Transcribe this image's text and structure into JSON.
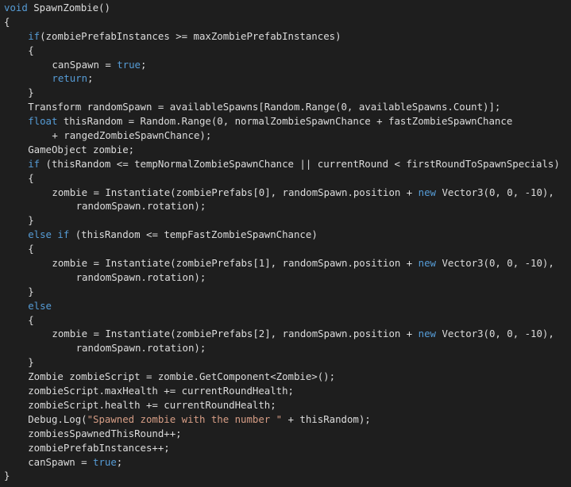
{
  "theme": {
    "background": "#1e1e1e",
    "text_color": "#dcdcdc",
    "keyword_color": "#569cd6",
    "string_color": "#d69d85"
  },
  "code": {
    "language": "C#",
    "lines": [
      {
        "indent": 0,
        "tokens": [
          {
            "t": "kw",
            "v": "void"
          },
          {
            "t": "txt",
            "v": " SpawnZombie()"
          }
        ]
      },
      {
        "indent": 0,
        "tokens": [
          {
            "t": "txt",
            "v": "{"
          }
        ]
      },
      {
        "indent": 1,
        "tokens": [
          {
            "t": "kw",
            "v": "if"
          },
          {
            "t": "txt",
            "v": "(zombiePrefabInstances >= maxZombiePrefabInstances)"
          }
        ]
      },
      {
        "indent": 1,
        "tokens": [
          {
            "t": "txt",
            "v": "{"
          }
        ]
      },
      {
        "indent": 2,
        "tokens": [
          {
            "t": "txt",
            "v": "canSpawn = "
          },
          {
            "t": "kw",
            "v": "true"
          },
          {
            "t": "txt",
            "v": ";"
          }
        ]
      },
      {
        "indent": 2,
        "tokens": [
          {
            "t": "kw",
            "v": "return"
          },
          {
            "t": "txt",
            "v": ";"
          }
        ]
      },
      {
        "indent": 1,
        "tokens": [
          {
            "t": "txt",
            "v": "}"
          }
        ]
      },
      {
        "indent": 1,
        "tokens": [
          {
            "t": "txt",
            "v": "Transform randomSpawn = availableSpawns[Random.Range(0, availableSpawns.Count)];"
          }
        ]
      },
      {
        "indent": 1,
        "tokens": [
          {
            "t": "kw",
            "v": "float"
          },
          {
            "t": "txt",
            "v": " thisRandom = Random.Range(0, normalZombieSpawnChance + fastZombieSpawnChance"
          }
        ]
      },
      {
        "indent": 2,
        "tokens": [
          {
            "t": "txt",
            "v": "+ rangedZombieSpawnChance);"
          }
        ]
      },
      {
        "indent": 1,
        "tokens": [
          {
            "t": "txt",
            "v": "GameObject zombie;"
          }
        ]
      },
      {
        "indent": 1,
        "tokens": [
          {
            "t": "kw",
            "v": "if"
          },
          {
            "t": "txt",
            "v": " (thisRandom <= tempNormalZombieSpawnChance || currentRound < firstRoundToSpawnSpecials)"
          }
        ]
      },
      {
        "indent": 1,
        "tokens": [
          {
            "t": "txt",
            "v": "{"
          }
        ]
      },
      {
        "indent": 2,
        "tokens": [
          {
            "t": "txt",
            "v": "zombie = Instantiate(zombiePrefabs[0], randomSpawn.position + "
          },
          {
            "t": "kw",
            "v": "new"
          },
          {
            "t": "txt",
            "v": " Vector3(0, 0, -10),"
          }
        ]
      },
      {
        "indent": 3,
        "tokens": [
          {
            "t": "txt",
            "v": "randomSpawn.rotation);"
          }
        ]
      },
      {
        "indent": 1,
        "tokens": [
          {
            "t": "txt",
            "v": "}"
          }
        ]
      },
      {
        "indent": 1,
        "tokens": [
          {
            "t": "kw",
            "v": "else if"
          },
          {
            "t": "txt",
            "v": " (thisRandom <= tempFastZombieSpawnChance)"
          }
        ]
      },
      {
        "indent": 1,
        "tokens": [
          {
            "t": "txt",
            "v": "{"
          }
        ]
      },
      {
        "indent": 2,
        "tokens": [
          {
            "t": "txt",
            "v": "zombie = Instantiate(zombiePrefabs[1], randomSpawn.position + "
          },
          {
            "t": "kw",
            "v": "new"
          },
          {
            "t": "txt",
            "v": " Vector3(0, 0, -10),"
          }
        ]
      },
      {
        "indent": 3,
        "tokens": [
          {
            "t": "txt",
            "v": "randomSpawn.rotation);"
          }
        ]
      },
      {
        "indent": 1,
        "tokens": [
          {
            "t": "txt",
            "v": "}"
          }
        ]
      },
      {
        "indent": 1,
        "tokens": [
          {
            "t": "kw",
            "v": "else"
          }
        ]
      },
      {
        "indent": 1,
        "tokens": [
          {
            "t": "txt",
            "v": "{"
          }
        ]
      },
      {
        "indent": 2,
        "tokens": [
          {
            "t": "txt",
            "v": "zombie = Instantiate(zombiePrefabs[2], randomSpawn.position + "
          },
          {
            "t": "kw",
            "v": "new"
          },
          {
            "t": "txt",
            "v": " Vector3(0, 0, -10),"
          }
        ]
      },
      {
        "indent": 3,
        "tokens": [
          {
            "t": "txt",
            "v": "randomSpawn.rotation);"
          }
        ]
      },
      {
        "indent": 1,
        "tokens": [
          {
            "t": "txt",
            "v": "}"
          }
        ]
      },
      {
        "indent": 1,
        "tokens": [
          {
            "t": "txt",
            "v": "Zombie zombieScript = zombie.GetComponent<Zombie>();"
          }
        ]
      },
      {
        "indent": 1,
        "tokens": [
          {
            "t": "txt",
            "v": "zombieScript.maxHealth += currentRoundHealth;"
          }
        ]
      },
      {
        "indent": 1,
        "tokens": [
          {
            "t": "txt",
            "v": "zombieScript.health += currentRoundHealth;"
          }
        ]
      },
      {
        "indent": 1,
        "tokens": [
          {
            "t": "txt",
            "v": "Debug.Log("
          },
          {
            "t": "str",
            "v": "\"Spawned zombie with the number \""
          },
          {
            "t": "txt",
            "v": " + thisRandom);"
          }
        ]
      },
      {
        "indent": 1,
        "tokens": [
          {
            "t": "txt",
            "v": "zombiesSpawnedThisRound++;"
          }
        ]
      },
      {
        "indent": 1,
        "tokens": [
          {
            "t": "txt",
            "v": "zombiePrefabInstances++;"
          }
        ]
      },
      {
        "indent": 1,
        "tokens": [
          {
            "t": "txt",
            "v": "canSpawn = "
          },
          {
            "t": "kw",
            "v": "true"
          },
          {
            "t": "txt",
            "v": ";"
          }
        ]
      },
      {
        "indent": 0,
        "tokens": [
          {
            "t": "txt",
            "v": "}"
          }
        ]
      }
    ]
  }
}
